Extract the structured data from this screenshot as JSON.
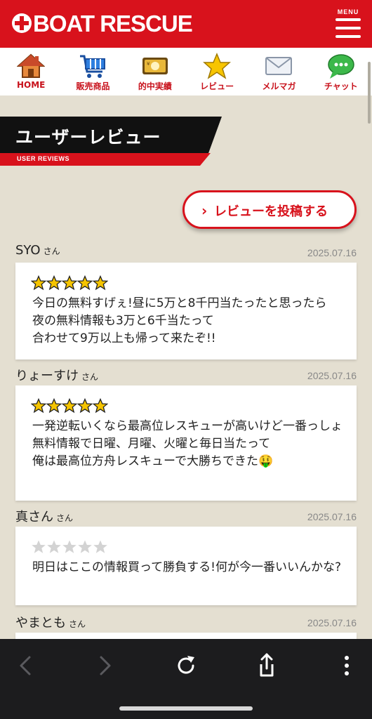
{
  "header": {
    "logo_text": "BOAT RESCUE",
    "menu_label": "MENU"
  },
  "nav": [
    {
      "label": "HOME",
      "icon": "house-icon"
    },
    {
      "label": "販売商品",
      "icon": "cart-icon"
    },
    {
      "label": "的中実績",
      "icon": "money-icon"
    },
    {
      "label": "レビュー",
      "icon": "star-icon"
    },
    {
      "label": "メルマガ",
      "icon": "mail-icon"
    },
    {
      "label": "チャット",
      "icon": "chat-icon"
    }
  ],
  "section": {
    "title": "ユーザーレビュー",
    "subtitle": "USER REVIEWS"
  },
  "post_button": {
    "label": "レビューを投稿する"
  },
  "reviews": [
    {
      "name": "SYO",
      "suffix": "さん",
      "date": "2025.07.16",
      "rating": 5,
      "text": "今日の無料すげぇ!昼に5万と8千円当たったと思ったら\n夜の無料情報も3万と6千当たって\n合わせて9万以上も帰って来たぞ!!"
    },
    {
      "name": "りょーすけ",
      "suffix": "さん",
      "date": "2025.07.16",
      "rating": 5,
      "text": "一発逆転いくなら最高位レスキューが高いけど一番っしょ\n無料情報で日曜、月曜、火曜と毎日当たって\n俺は最高位方舟レスキューで大勝ちできた🤑"
    },
    {
      "name": "真さん",
      "suffix": "さん",
      "date": "2025.07.16",
      "rating": 0,
      "text": "明日はここの情報買って勝負する!何が今一番いいんかな?"
    },
    {
      "name": "やまとも",
      "suffix": "さん",
      "date": "2025.07.16",
      "rating": 0,
      "text": ""
    }
  ],
  "colors": {
    "brand": "#d8121c",
    "background": "#e4dfd1",
    "star": "#f5c400"
  },
  "toolbar": {
    "icons": [
      "back-icon",
      "forward-icon",
      "reload-icon",
      "share-icon",
      "more-icon"
    ]
  }
}
